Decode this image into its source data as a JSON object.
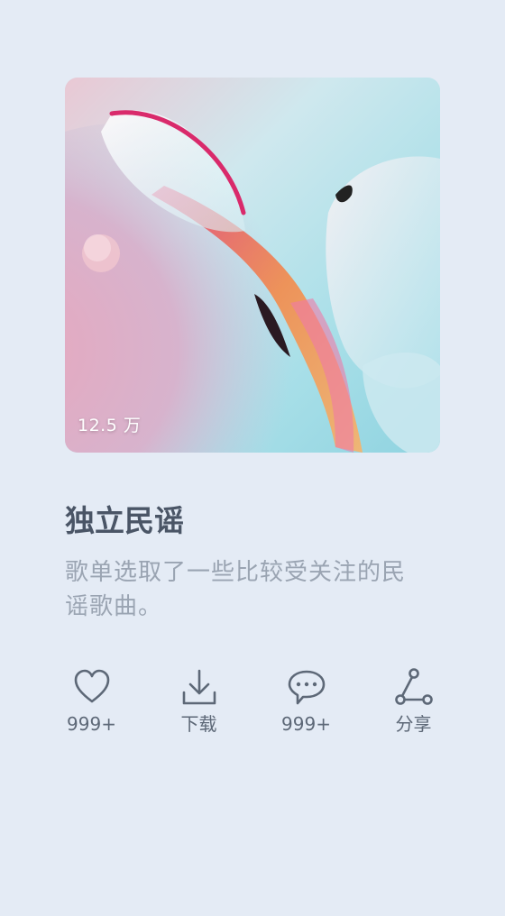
{
  "playlist": {
    "play_count": "12.5 万",
    "title": "独立民谣",
    "description": "歌单选取了一些比较受关注的民谣歌曲。"
  },
  "actions": [
    {
      "icon": "heart-icon",
      "label": "999+"
    },
    {
      "icon": "download-icon",
      "label": "下载"
    },
    {
      "icon": "comment-icon",
      "label": "999+"
    },
    {
      "icon": "share-icon",
      "label": "分享"
    }
  ],
  "colors": {
    "background": "#e4ebf5",
    "title": "#4a5566",
    "description": "#9aa4b2",
    "icon": "#5d6877"
  }
}
